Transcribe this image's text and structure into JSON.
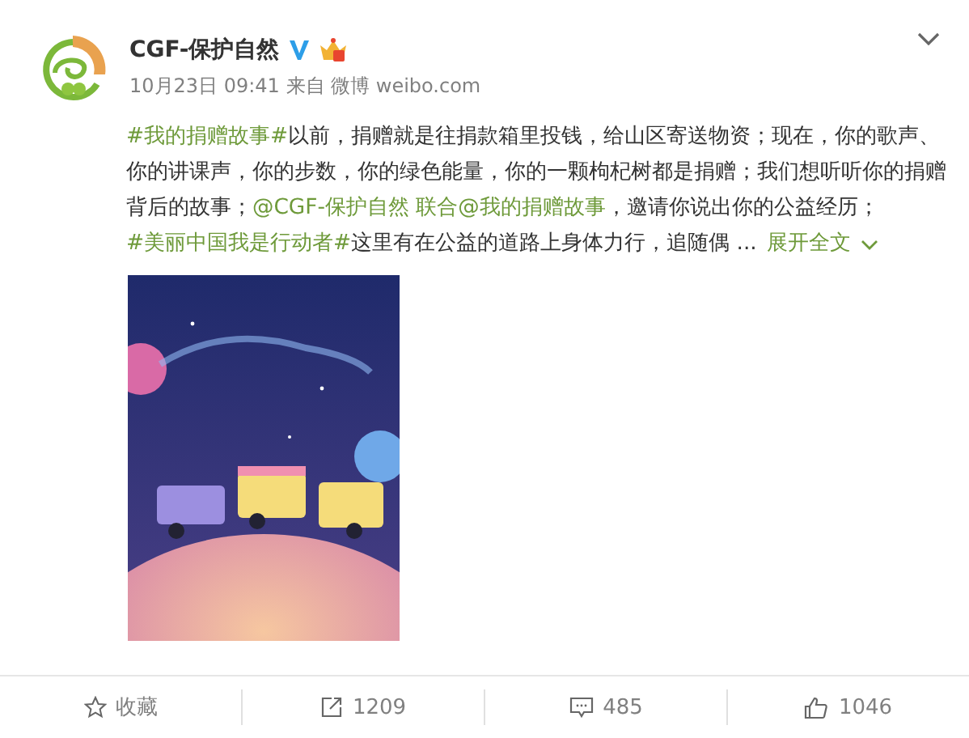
{
  "author": {
    "name": "CGF-保护自然"
  },
  "meta": "10月23日 09:41 来自 微博 weibo.com",
  "paragraphs": [
    {
      "segments": [
        {
          "kind": "link",
          "text": "#我的捐赠故事#"
        },
        {
          "kind": "text",
          "text": "以前，捐赠就是往捐款箱里投钱，给山区寄送物资；现在，你的歌声、你的讲课声，你的步数，你的绿色能量，你的一颗枸杞树都是捐赠；我们想听听你的捐赠背后的故事；"
        },
        {
          "kind": "link",
          "text": "@CGF-保护自然 联合@我的捐赠故事"
        },
        {
          "kind": "text",
          "text": "，邀请你说出你的公益经历；"
        }
      ]
    },
    {
      "segments": [
        {
          "kind": "link",
          "text": "#美丽中国我是行动者#"
        },
        {
          "kind": "text",
          "text": "这里有在公益的道路上身体力行，追随偶 ..."
        },
        {
          "kind": "expand",
          "text": "展开全文"
        }
      ]
    }
  ],
  "actions": [
    {
      "kind": "favorite",
      "label": "收藏"
    },
    {
      "kind": "repost",
      "label": "1209"
    },
    {
      "kind": "comment",
      "label": "485"
    },
    {
      "kind": "like",
      "label": "1046"
    }
  ]
}
